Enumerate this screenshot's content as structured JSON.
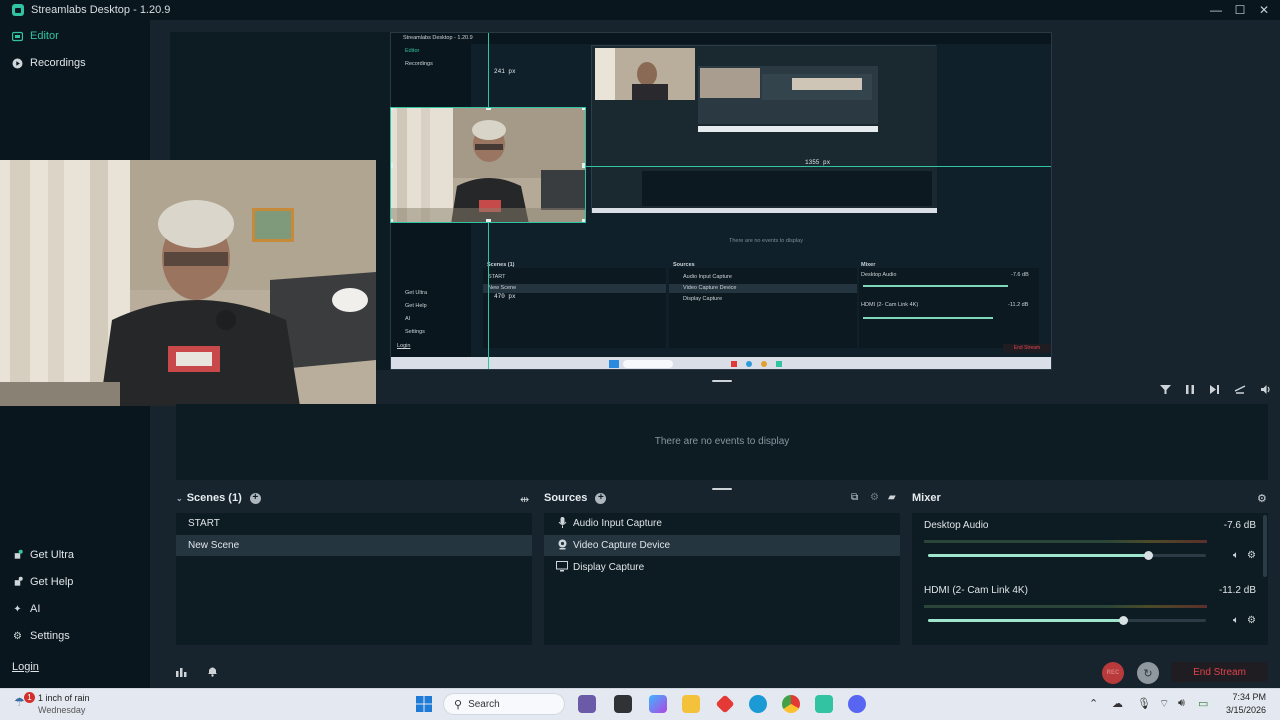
{
  "window": {
    "title": "Streamlabs Desktop - 1.20.9",
    "minimize": "—",
    "maximize": "☐",
    "close": "✕"
  },
  "nav": {
    "editor": "Editor",
    "recordings": "Recordings",
    "get_ultra": "Get Ultra",
    "get_help": "Get Help",
    "ai": "AI",
    "settings": "Settings",
    "login": "Login"
  },
  "preview": {
    "inner_title": "Streamlabs Desktop - 1.20.9",
    "inner_nav": [
      "Editor",
      "Recordings"
    ],
    "inner_nav_bottom": [
      "Get Ultra",
      "Get Help",
      "AI",
      "Settings",
      "Login"
    ],
    "ruler_top": "241 px",
    "ruler_right": "1355 px",
    "ruler_bottom": "470 px",
    "inner_events_empty": "There are no events to display",
    "inner_scenes_title": "Scenes (1)",
    "inner_scenes": [
      "START",
      "New Scene"
    ],
    "inner_sources_title": "Sources",
    "inner_sources": [
      "Audio Input Capture",
      "Video Capture Device",
      "Display Capture"
    ],
    "inner_mixer_title": "Mixer",
    "inner_mixer": [
      {
        "name": "Desktop Audio",
        "db": "-7.6 dB"
      },
      {
        "name": "HDMI (2- Cam Link 4K)",
        "db": "-11.2 dB"
      }
    ],
    "inner_end_stream": "End Stream"
  },
  "events": {
    "empty_text": "There are no events to display",
    "toolbar_icons": [
      "filter-icon",
      "pause-icon",
      "skip-icon",
      "mute-alerts-icon",
      "volume-icon"
    ]
  },
  "scenes": {
    "title": "Scenes (1)",
    "items": [
      "START",
      "New Scene"
    ],
    "selected": "New Scene"
  },
  "sources": {
    "title": "Sources",
    "items": [
      {
        "label": "Audio Input Capture",
        "icon": "microphone-icon"
      },
      {
        "label": "Video Capture Device",
        "icon": "webcam-icon"
      },
      {
        "label": "Display Capture",
        "icon": "monitor-icon"
      }
    ],
    "selected": "Video Capture Device"
  },
  "mixer": {
    "title": "Mixer",
    "channels": [
      {
        "name": "Desktop Audio",
        "db": "-7.6 dB",
        "level": 0.79
      },
      {
        "name": "HDMI (2- Cam Link 4K)",
        "db": "-11.2 dB",
        "level": 0.7
      }
    ]
  },
  "status": {
    "rec_label": "REC",
    "end_stream": "End Stream"
  },
  "taskbar": {
    "weather_badge": "1",
    "weather": "1 inch of rain",
    "weather_day": "Wednesday",
    "search_placeholder": "Search",
    "time": "7:34 PM",
    "date": "3/15/2026"
  },
  "colors": {
    "accent": "#31c3a2",
    "end_stream": "#e0434b",
    "background": "#17242d",
    "panel": "#0d1b22",
    "nav": "#09161d"
  }
}
